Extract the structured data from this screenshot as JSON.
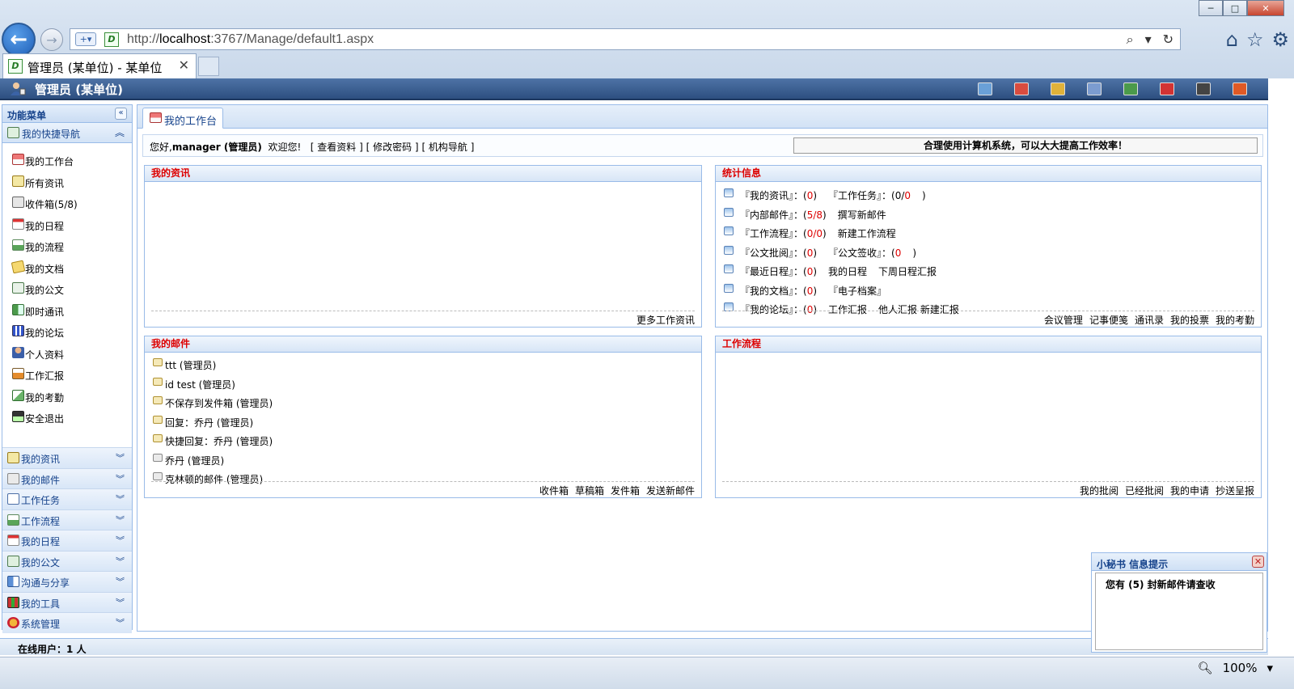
{
  "browser": {
    "url_prefix": "http://",
    "url_host": "localhost",
    "url_rest": ":3767/Manage/default1.aspx",
    "tab_title": "管理员 (某单位) - 某单位",
    "zoom": "100%"
  },
  "header": {
    "title": "管理员 (某单位)",
    "icons": [
      {
        "name": "notes-icon",
        "color": "#6aa0d8"
      },
      {
        "name": "home-icon",
        "color": "#d94c3f"
      },
      {
        "name": "clipboard-icon",
        "color": "#e0b23a"
      },
      {
        "name": "mail-icon",
        "color": "#7c9cd0"
      },
      {
        "name": "contacts-icon",
        "color": "#4b9a4b"
      },
      {
        "name": "calendar-icon",
        "color": "#d33333"
      },
      {
        "name": "user-icon",
        "color": "#444444"
      },
      {
        "name": "power-icon",
        "color": "#e05a26"
      }
    ]
  },
  "sidebar": {
    "title": "功能菜单",
    "open_section": "我的快捷导航",
    "quick_items": [
      {
        "label": "我的工作台",
        "icon": "home-icon",
        "cls": "g-home"
      },
      {
        "label": "所有资讯",
        "icon": "news-icon",
        "cls": "g-news"
      },
      {
        "label": "收件箱(5/8)",
        "icon": "inbox-icon",
        "cls": "g-inbox"
      },
      {
        "label": "我的日程",
        "icon": "calendar-icon",
        "cls": "g-cal"
      },
      {
        "label": "我的流程",
        "icon": "flow-icon",
        "cls": "g-flow"
      },
      {
        "label": "我的文档",
        "icon": "folder-icon",
        "cls": "g-doc"
      },
      {
        "label": "我的公文",
        "icon": "document-icon",
        "cls": "g-paper"
      },
      {
        "label": "即时通讯",
        "icon": "chat-icon",
        "cls": "g-im"
      },
      {
        "label": "我的论坛",
        "icon": "forum-icon",
        "cls": "g-grid"
      },
      {
        "label": "个人资料",
        "icon": "person-icon",
        "cls": "g-person"
      },
      {
        "label": "工作汇报",
        "icon": "report-icon",
        "cls": "g-report"
      },
      {
        "label": "我的考勤",
        "icon": "attendance-icon",
        "cls": "g-att"
      },
      {
        "label": "安全退出",
        "icon": "logout-icon",
        "cls": "g-exit"
      }
    ],
    "sections": [
      {
        "label": "我的资讯",
        "icon": "news-icon",
        "cls": "g-news"
      },
      {
        "label": "我的邮件",
        "icon": "mail-icon",
        "cls": "g-mailr"
      },
      {
        "label": "工作任务",
        "icon": "book-icon",
        "cls": "g-book"
      },
      {
        "label": "工作流程",
        "icon": "flow-icon",
        "cls": "g-flow"
      },
      {
        "label": "我的日程",
        "icon": "calendar-icon",
        "cls": "g-cal"
      },
      {
        "label": "我的公文",
        "icon": "document-icon",
        "cls": "g-pub"
      },
      {
        "label": "沟通与分享",
        "icon": "share-icon",
        "cls": "g-share"
      },
      {
        "label": "我的工具",
        "icon": "tools-icon",
        "cls": "g-tool"
      },
      {
        "label": "系统管理",
        "icon": "system-icon",
        "cls": "g-sys"
      }
    ]
  },
  "main": {
    "tab_label": "我的工作台",
    "welcome": {
      "greeting": "您好,",
      "user": "manager (管理员)",
      "text": "欢迎您!",
      "link_profile": "[ 查看资料 ]",
      "link_password": "[ 修改密码 ]",
      "link_org": "[ 机构导航 ]",
      "slogan": "合理使用计算机系统，可以大大提高工作效率！"
    },
    "news": {
      "title": "我的资讯",
      "footer": [
        "更多工作资讯"
      ]
    },
    "stats": {
      "title": "统计信息",
      "rows": [
        {
          "a": "『我的资讯』：(",
          "v1": "0",
          "b": ")",
          "c": "『工作任务』：(",
          "v2": "0/",
          "v3": "0",
          "d": ")"
        },
        {
          "a": "『内部邮件』：(",
          "v1": "5/8",
          "b": ")",
          "c": "撰写新邮件",
          "v2": "",
          "v3": "",
          "d": ""
        },
        {
          "a": "『工作流程』：(",
          "v1": "0/0",
          "b": ")",
          "c": "新建工作流程",
          "v2": "",
          "v3": "",
          "d": ""
        },
        {
          "a": "『公文批阅』：(",
          "v1": "0",
          "b": ")",
          "c": "『公文签收』：(",
          "v2": "",
          "v3": "0",
          "d": ")"
        },
        {
          "a": "『最近日程』：(",
          "v1": "0",
          "b": ")",
          "c": "我的日程",
          "v2": "",
          "v3": "",
          "d": "下周日程汇报"
        },
        {
          "a": "『我的文档』：(",
          "v1": "0",
          "b": ")",
          "c": "『电子档案』",
          "v2": "",
          "v3": "",
          "d": ""
        },
        {
          "a": "『我的论坛』：(",
          "v1": "0",
          "b": ")",
          "c": "工作汇报",
          "v2": "",
          "v3": "",
          "d": "他人汇报  新建汇报"
        }
      ],
      "footer": [
        "会议管理",
        "记事便笺",
        "通讯录",
        "我的投票",
        "我的考勤"
      ]
    },
    "mail": {
      "title": "我的邮件",
      "items": [
        {
          "subject": "ttt (管理员)",
          "read": false
        },
        {
          "subject": "id test (管理员)",
          "read": false
        },
        {
          "subject": "不保存到发件箱 (管理员)",
          "read": false
        },
        {
          "subject": "回复：乔丹 (管理员)",
          "read": false
        },
        {
          "subject": "快捷回复：乔丹 (管理员)",
          "read": false
        },
        {
          "subject": "乔丹 (管理员)",
          "read": true
        },
        {
          "subject": "克林顿的邮件 (管理员)",
          "read": true
        }
      ],
      "footer": [
        "收件箱",
        "草稿箱",
        "发件箱",
        "发送新邮件"
      ]
    },
    "flow": {
      "title": "工作流程",
      "footer": [
        "我的批阅",
        "已经批阅",
        "我的申请",
        "抄送呈报"
      ]
    }
  },
  "status": {
    "online": "在线用户：1 人"
  },
  "popup": {
    "title": "小秘书 信息提示",
    "message": "您有 (5) 封新邮件请查收"
  }
}
